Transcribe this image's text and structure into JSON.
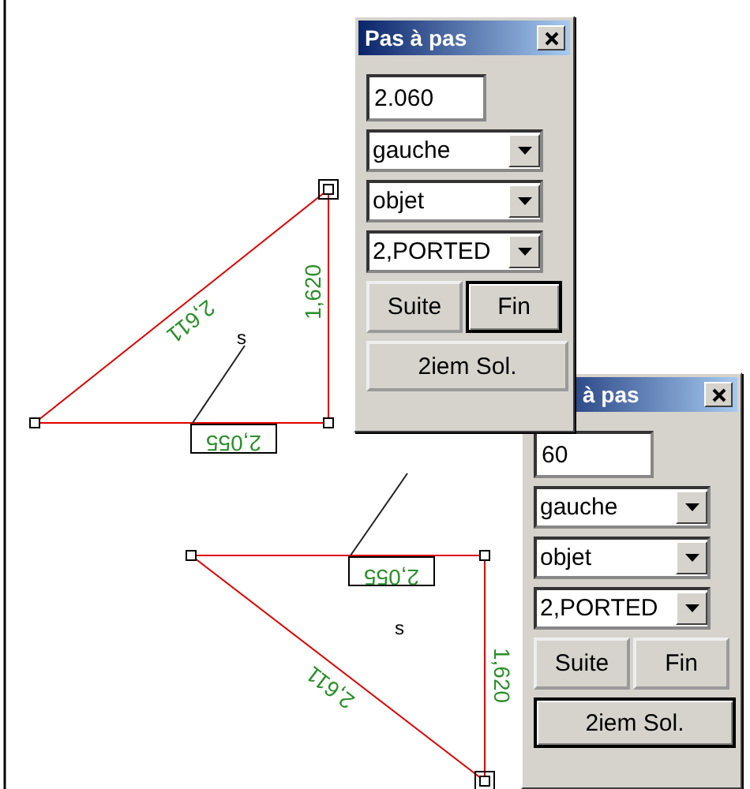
{
  "canvas": {
    "figures": [
      {
        "hypotenuse": "2,611",
        "side": "1,620",
        "base": "2,055",
        "point": "s"
      },
      {
        "hypotenuse": "2,611",
        "side": "1,620",
        "base": "2,055",
        "point": "s"
      }
    ]
  },
  "dialogs": [
    {
      "title": "Pas à pas",
      "value": "2.060",
      "selects": [
        "gauche",
        "objet",
        "2,PORTED"
      ],
      "buttons": [
        {
          "label": "Suite",
          "default": false
        },
        {
          "label": "Fin",
          "default": true
        }
      ],
      "wide_button": {
        "label": "2iem Sol.",
        "default": false
      }
    },
    {
      "title": "à pas",
      "value": "60",
      "selects": [
        "gauche",
        "objet",
        "2,PORTED"
      ],
      "buttons": [
        {
          "label": "Suite",
          "default": false
        },
        {
          "label": "Fin",
          "default": false
        }
      ],
      "wide_button": {
        "label": "2iem Sol.",
        "default": true
      }
    }
  ]
}
